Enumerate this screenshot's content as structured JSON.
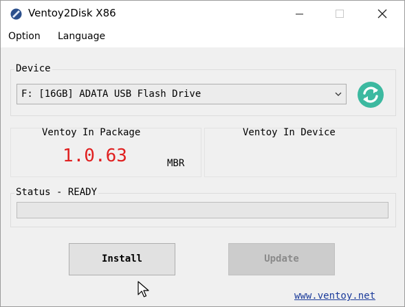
{
  "window": {
    "title": "Ventoy2Disk  X86",
    "controls": {
      "minimize_icon": "minimize-icon",
      "maximize_icon": "maximize-icon",
      "close_icon": "close-icon"
    }
  },
  "menu": {
    "items": [
      "Option",
      "Language"
    ]
  },
  "device": {
    "label": "Device",
    "selected": "F: [16GB] ADATA USB Flash Drive",
    "refresh_icon": "refresh-icon",
    "refresh_color": "#3cb9a0"
  },
  "package": {
    "label": "Ventoy In Package",
    "version": "1.0.63",
    "version_color": "#e02020",
    "partition_style": "MBR"
  },
  "in_device": {
    "label": "Ventoy In Device",
    "version": "",
    "partition_style": ""
  },
  "status": {
    "label": "Status - READY",
    "progress": 0
  },
  "buttons": {
    "install": "Install",
    "update": "Update",
    "update_enabled": false
  },
  "footer": {
    "link": "www.ventoy.net"
  }
}
